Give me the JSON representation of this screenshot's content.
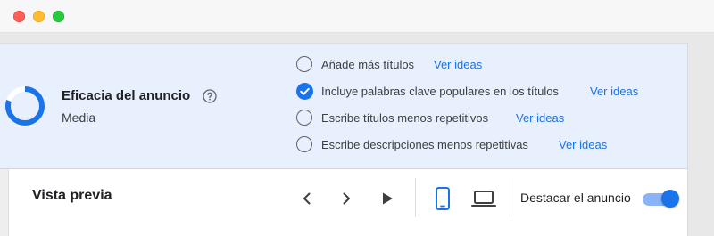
{
  "window": {
    "controls": [
      "close",
      "minimize",
      "zoom"
    ]
  },
  "ad_strength": {
    "title": "Eficacia del anuncio",
    "level": "Media",
    "help_icon": "help-outline-icon",
    "ring_progress": 0.8,
    "accent_color": "#1a73e8",
    "suggestions": [
      {
        "text": "Añade más títulos",
        "link": "Ver ideas",
        "checked": false
      },
      {
        "text": "Incluye palabras clave populares en los títulos",
        "link": "Ver ideas",
        "checked": true
      },
      {
        "text": "Escribe títulos menos repetitivos",
        "link": "Ver ideas",
        "checked": false
      },
      {
        "text": "Escribe descripciones menos repetitivas",
        "link": "Ver ideas",
        "checked": false
      }
    ]
  },
  "preview": {
    "title": "Vista previa",
    "icons": [
      "chevron-left-icon",
      "chevron-right-icon",
      "play-icon",
      "mobile-phone-icon",
      "laptop-icon"
    ],
    "highlight_label": "Destacar el anuncio",
    "highlight_on": true
  }
}
